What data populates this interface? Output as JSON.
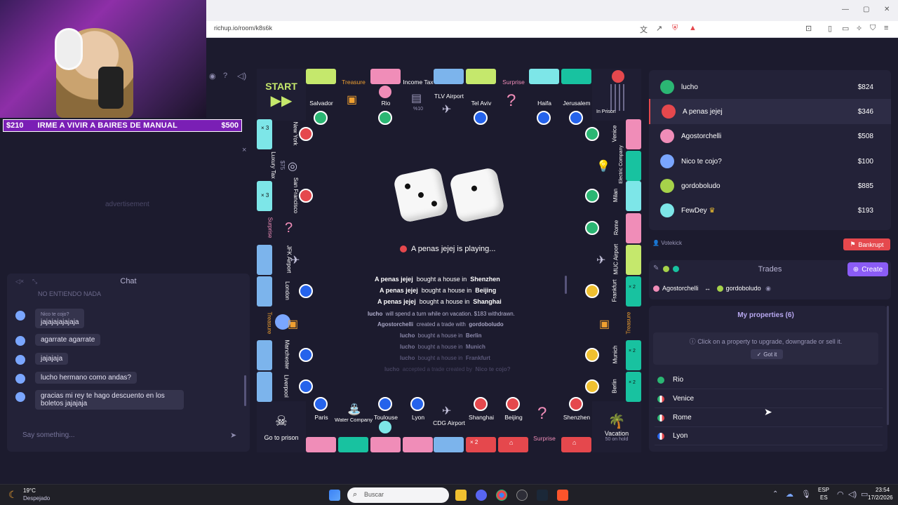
{
  "browser": {
    "url": "richup.io/room/k8s6k"
  },
  "overlay": {
    "ticker_left": "$210",
    "ticker_text": "IRME A VIVIR A BAIRES DE MANUAL",
    "ticker_right": "$500",
    "close_symbol": "×"
  },
  "left": {
    "advertisement": "advertisement"
  },
  "chat": {
    "title": "Chat",
    "partial_top": "NO ENTIENDO NADA",
    "messages": [
      {
        "sender": "Nico te cojo?",
        "text": "jajajajajajaja"
      },
      {
        "sender": "",
        "text": "agarrate agarrate"
      },
      {
        "sender": "",
        "text": "jajajaja"
      },
      {
        "sender": "",
        "text": "lucho hermano como andas?"
      },
      {
        "sender": "",
        "text": "gracias mi rey te hago descuento en los boletos jajajaja"
      }
    ],
    "placeholder": "Say something..."
  },
  "board": {
    "start": {
      "label": "START"
    },
    "go_to_prison": {
      "label": "Go to prison"
    },
    "vacation": {
      "label": "Vacation",
      "sub": "50 on hold"
    },
    "top": [
      {
        "name": "Salvador",
        "color": "#c5e86c"
      },
      {
        "name": "Treasure",
        "color": ""
      },
      {
        "name": "Rio",
        "color": "#f08db8"
      },
      {
        "name": "Income Tax",
        "sub": "%10",
        "color": ""
      },
      {
        "name": "TLV Airport",
        "color": "#7cb4ec"
      },
      {
        "name": "Tel Aviv",
        "color": "#c5e86c"
      },
      {
        "name": "Surprise",
        "color": ""
      },
      {
        "name": "Haifa",
        "color": "#7de6e8"
      },
      {
        "name": "Jerusalem",
        "color": "#18c2a0"
      },
      {
        "name": "In Prison",
        "color": ""
      }
    ],
    "left": [
      {
        "name": "New York",
        "color": "#7de6e8"
      },
      {
        "name": "Luxury Tax",
        "sub": "$75",
        "color": ""
      },
      {
        "name": "San Francisco",
        "color": "#7de6e8"
      },
      {
        "name": "Surprise",
        "color": ""
      },
      {
        "name": "JFK Airport",
        "color": "#7cb4ec"
      },
      {
        "name": "London",
        "color": "#7cb4ec"
      },
      {
        "name": "Treasure",
        "color": ""
      },
      {
        "name": "Manchester",
        "color": "#7cb4ec"
      },
      {
        "name": "Liverpool",
        "color": "#7cb4ec"
      }
    ],
    "right": [
      {
        "name": "Venice",
        "color": "#f08db8"
      },
      {
        "name": "Electric Company",
        "color": "#18c2a0"
      },
      {
        "name": "Milan",
        "color": "#7de6e8"
      },
      {
        "name": "Rome",
        "color": "#f08db8"
      },
      {
        "name": "MUC Airport",
        "color": "#c5e86c"
      },
      {
        "name": "Frankfurt",
        "color": "#18c2a0"
      },
      {
        "name": "Treasure",
        "color": ""
      },
      {
        "name": "Munich",
        "color": "#18c2a0"
      },
      {
        "name": "Berlin",
        "color": "#18c2a0"
      }
    ],
    "bottom": [
      {
        "name": "Paris",
        "color": "#f08db8"
      },
      {
        "name": "Water Company",
        "color": "#18c2a0"
      },
      {
        "name": "Toulouse",
        "color": "#f08db8"
      },
      {
        "name": "Lyon",
        "color": "#f08db8"
      },
      {
        "name": "CDG Airport",
        "color": "#7cb4ec"
      },
      {
        "name": "Shanghai",
        "color": "#e5484d",
        "badge": "× 2"
      },
      {
        "name": "Beijing",
        "color": "#e5484d"
      },
      {
        "name": "Surprise",
        "color": ""
      },
      {
        "name": "Shenzhen",
        "color": "#e5484d"
      }
    ],
    "multipliers": {
      "x2": "× 2",
      "x3": "× 3"
    },
    "playing_text": "A penas jejej  is playing...",
    "log": [
      {
        "player": "A penas jejej",
        "action": "bought a house in",
        "target": "Shenzhen"
      },
      {
        "player": "A penas jejej",
        "action": "bought a house in",
        "target": "Beijing"
      },
      {
        "player": "A penas jejej",
        "action": "bought a house in",
        "target": "Shanghai"
      },
      {
        "player": "lucho",
        "action": "will spend a turn while on vacation. $183 withdrawn.",
        "target": ""
      },
      {
        "player": "Agostorchelli",
        "action": "created a trade with",
        "target": "gordoboludo"
      },
      {
        "player": "lucho",
        "action": "bought a house in",
        "target": "Berlin"
      },
      {
        "player": "lucho",
        "action": "bought a house in",
        "target": "Munich"
      },
      {
        "player": "lucho",
        "action": "bought a house in",
        "target": "Frankfurt"
      },
      {
        "player": "lucho",
        "action": "accepted a trade created by",
        "target": "Nico te cojo?"
      }
    ]
  },
  "players": [
    {
      "name": "lucho",
      "money": "$824",
      "color": "#2bb673",
      "crown": ""
    },
    {
      "name": "A penas jejej",
      "money": "$346",
      "color": "#e5484d",
      "crown": ""
    },
    {
      "name": "Agostorchelli",
      "money": "$508",
      "color": "#f08db8",
      "crown": ""
    },
    {
      "name": "Nico te cojo?",
      "money": "$100",
      "color": "#7aa6ff",
      "crown": ""
    },
    {
      "name": "gordoboludo",
      "money": "$885",
      "color": "#a6d24a",
      "crown": ""
    },
    {
      "name": "FewDey",
      "money": "$193",
      "color": "#7de6e8",
      "crown": "♛"
    }
  ],
  "actions": {
    "votekick": "Votekick",
    "bankrupt": "Bankrupt"
  },
  "trades": {
    "title": "Trades",
    "create": "Create",
    "trade_from": "Agostorchelli",
    "trade_arrow": "↔",
    "trade_to": "gordoboludo"
  },
  "properties": {
    "title": "My properties (6)",
    "hint": "Click on a property to upgrade, downgrade or sell it.",
    "got_it": "Got it",
    "items": [
      {
        "name": "Rio",
        "flag": "#2bb673"
      },
      {
        "name": "Venice",
        "flag": "#2bb673"
      },
      {
        "name": "Rome",
        "flag": "#2bb673"
      },
      {
        "name": "Lyon",
        "flag": "#2563eb"
      }
    ]
  },
  "taskbar": {
    "weather_temp": "19°C",
    "weather_desc": "Despejado",
    "search": "Buscar",
    "lang_top": "ESP",
    "lang_bottom": "ES",
    "time": "23:54",
    "date": "17/2/2026"
  }
}
